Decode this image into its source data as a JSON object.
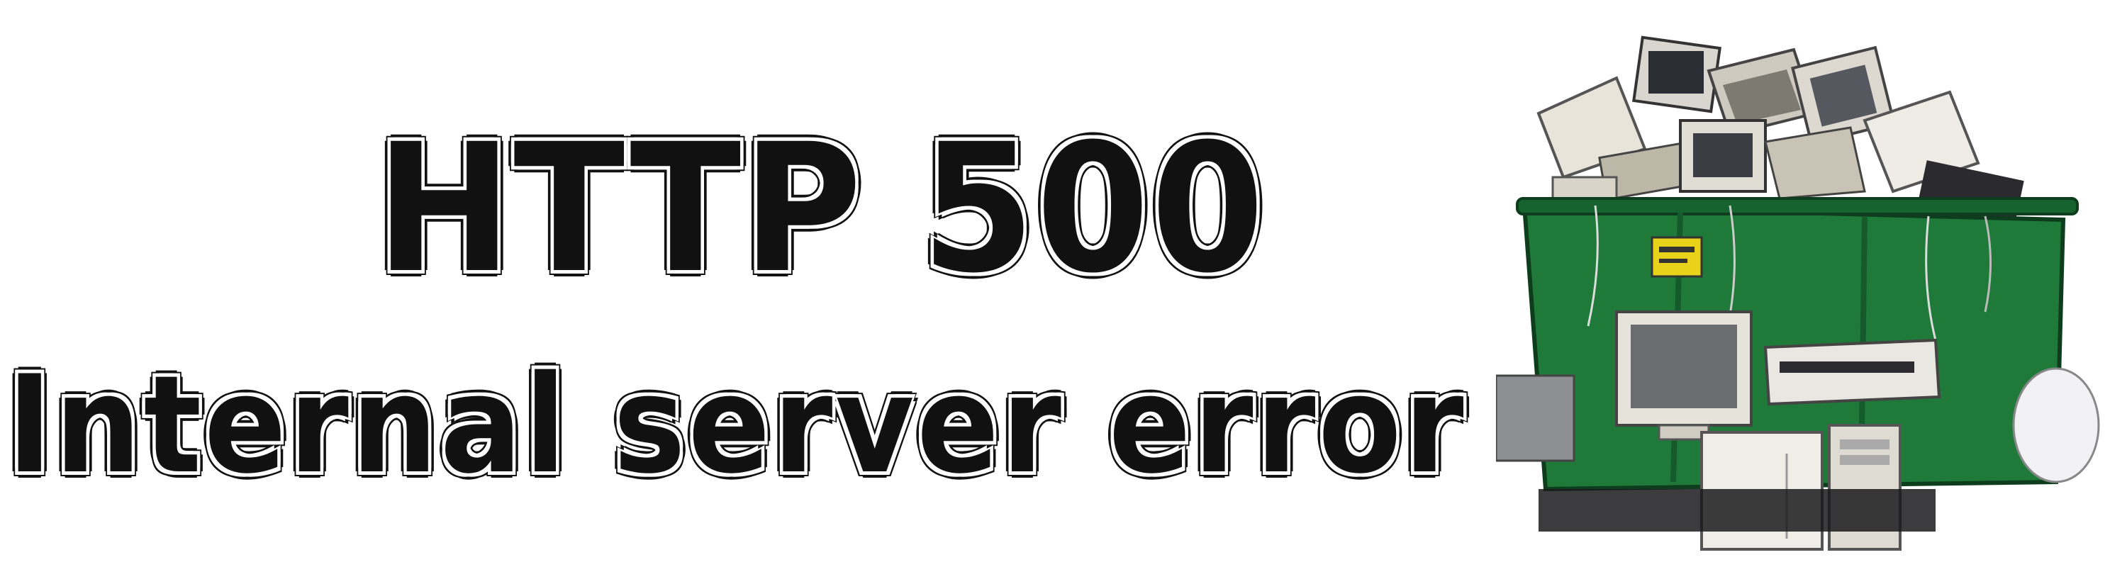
{
  "error": {
    "code_line": "HTTP 500",
    "message_line": "Internal server error"
  },
  "illustration": {
    "subject": "dumpster-full-of-computers",
    "dumpster_color": "#1f7a3a",
    "label_color": "#e8d21a"
  }
}
